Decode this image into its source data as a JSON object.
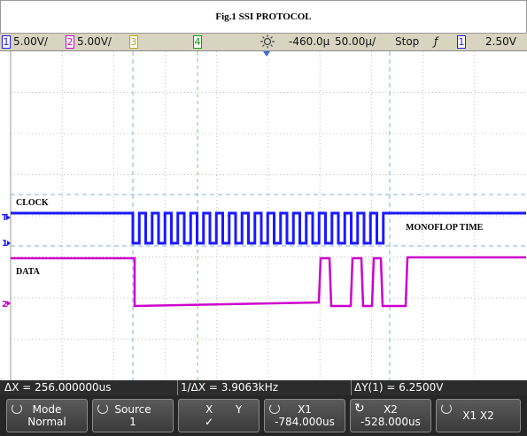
{
  "title": "Fig.1 SSI PROTOCOL",
  "status": {
    "ch1_num": "1",
    "ch1_scale": "5.00V/",
    "ch2_num": "2",
    "ch2_scale": "5.00V/",
    "ch3_num": "3",
    "ch4_num": "4",
    "delay": "-460.0µ",
    "timebase": "50.00µ/",
    "run_state": "Stop",
    "trigger_slope": "ƒ",
    "trigger_ch": "1",
    "trigger_level": "2.50V"
  },
  "labels": {
    "clock": "CLOCK",
    "data": "DATA",
    "monoflop": "MONOFLOP TIME",
    "marker_t": "T",
    "marker_1": "1",
    "marker_2": "2"
  },
  "readouts": {
    "delta_x": "ΔX = 256.000000us",
    "inv_delta_x": "1/ΔX = 3.9063kHz",
    "delta_y": "ΔY(1) = 6.2500V"
  },
  "softkeys": {
    "mode_label": "Mode",
    "mode_value": "Normal",
    "source_label": "Source",
    "source_value": "1",
    "x_label": "X",
    "y_label": "Y",
    "x_check": "✓",
    "x1_label": "X1",
    "x1_value": "-784.000us",
    "x2_label": "X2",
    "x2_value": "-528.000us",
    "x1x2_label": "X1 X2"
  },
  "colors": {
    "ch1": "#1a1aff",
    "ch2": "#cc00cc",
    "ch3": "#c8a000",
    "ch4": "#00a000",
    "cursor": "#7fb2e0"
  }
}
